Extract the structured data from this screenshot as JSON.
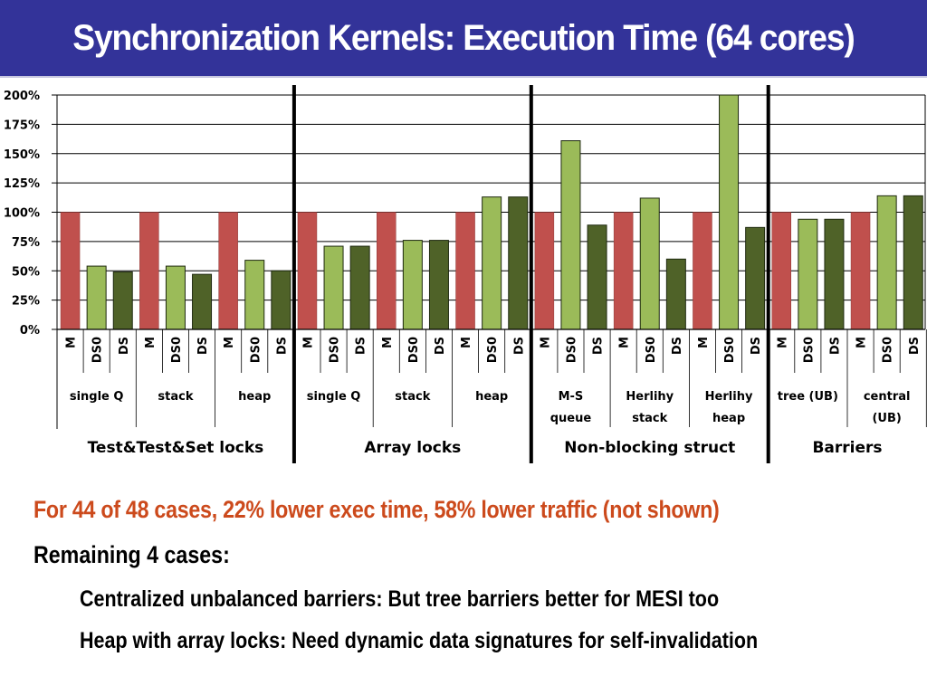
{
  "slide": {
    "title": "Synchronization Kernels: Execution Time (64 cores)"
  },
  "bullets": {
    "highlight": "For 44 of 48 cases, 22% lower exec time, 58% lower traffic (not shown)",
    "remaining": "Remaining 4 cases:",
    "sub": [
      "Centralized unbalanced barriers: But tree barriers better for MESI too",
      "Heap with array locks: Need dynamic data signatures for self-invalidation"
    ]
  },
  "chart_data": {
    "type": "bar",
    "title": "",
    "xlabel": "",
    "ylabel": "",
    "ylim": [
      0,
      200
    ],
    "yticks": [
      "0%",
      "25%",
      "50%",
      "75%",
      "100%",
      "125%",
      "150%",
      "175%",
      "200%"
    ],
    "grid": true,
    "legend": "none",
    "series_colors": {
      "M": "#c0504d",
      "DS0": "#9bbb59",
      "DS": "#4f6228"
    },
    "groups": [
      {
        "name": "Test&Test&Set locks",
        "benchmarks": [
          {
            "label": [
              "single Q"
            ],
            "values": {
              "M": 100,
              "DS0": 54,
              "DS": 49
            }
          },
          {
            "label": [
              "stack"
            ],
            "values": {
              "M": 100,
              "DS0": 54,
              "DS": 47
            }
          },
          {
            "label": [
              "heap"
            ],
            "values": {
              "M": 100,
              "DS0": 59,
              "DS": 50
            }
          }
        ]
      },
      {
        "name": "Array locks",
        "benchmarks": [
          {
            "label": [
              "single Q"
            ],
            "values": {
              "M": 100,
              "DS0": 71,
              "DS": 71
            }
          },
          {
            "label": [
              "stack"
            ],
            "values": {
              "M": 100,
              "DS0": 76,
              "DS": 76
            }
          },
          {
            "label": [
              "heap"
            ],
            "values": {
              "M": 100,
              "DS0": 113,
              "DS": 113
            }
          }
        ]
      },
      {
        "name": "Non-blocking struct",
        "benchmarks": [
          {
            "label": [
              "M-S",
              "queue"
            ],
            "values": {
              "M": 100,
              "DS0": 161,
              "DS": 89
            }
          },
          {
            "label": [
              "Herlihy",
              "stack"
            ],
            "values": {
              "M": 100,
              "DS0": 112,
              "DS": 60
            }
          },
          {
            "label": [
              "Herlihy",
              "heap"
            ],
            "values": {
              "M": 100,
              "DS0": 200,
              "DS": 87
            }
          }
        ]
      },
      {
        "name": "Barriers",
        "benchmarks": [
          {
            "label": [
              "tree (UB)"
            ],
            "values": {
              "M": 100,
              "DS0": 94,
              "DS": 94
            }
          },
          {
            "label": [
              "central",
              "(UB)"
            ],
            "values": {
              "M": 100,
              "DS0": 114,
              "DS": 114
            }
          }
        ]
      }
    ],
    "series_order": [
      "M",
      "DS0",
      "DS"
    ]
  }
}
